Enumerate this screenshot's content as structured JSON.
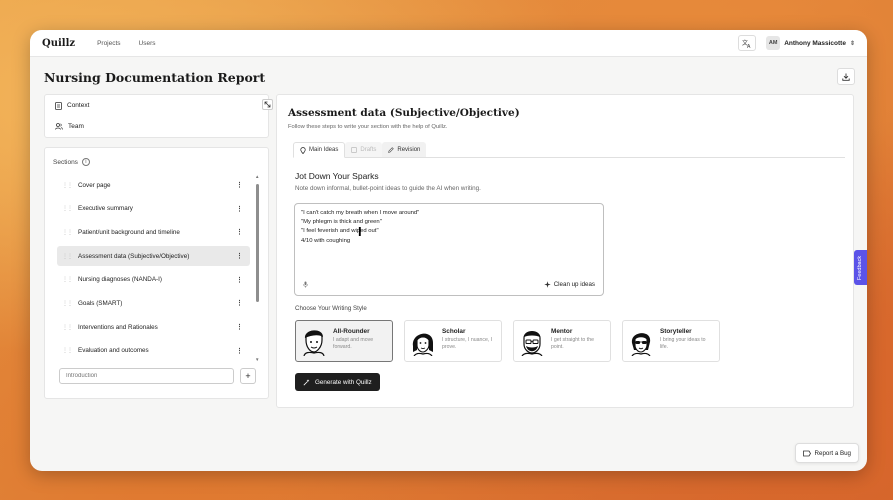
{
  "topbar": {
    "logo": "Quillz",
    "nav": [
      "Projects",
      "Users"
    ],
    "user_initials": "AM",
    "user_name": "Anthony Massicotte"
  },
  "page": {
    "title": "Nursing Documentation Report"
  },
  "context_panel": {
    "items": [
      "Context",
      "Team"
    ]
  },
  "sections": {
    "heading": "Sections",
    "items": [
      "Cover page",
      "Executive summary",
      "Patient/unit background and timeline",
      "Assessment data (Subjective/Objective)",
      "Nursing diagnoses (NANDA-I)",
      "Goals (SMART)",
      "Interventions and Rationales",
      "Evaluation and outcomes"
    ],
    "active_index": 3,
    "new_placeholder": "Introduction"
  },
  "main": {
    "title": "Assessment data (Subjective/Objective)",
    "subtitle": "Follow these steps to write your section with the help of Quillz.",
    "tabs": [
      "Main Ideas",
      "Drafts",
      "Revision"
    ],
    "step_title": "Jot Down Your Sparks",
    "step_desc": "Note down informal, bullet-point ideas to guide the AI when writing.",
    "ideas": [
      "\"I can't catch my breath when I move around\"",
      "\"My phlegm is thick and green\"",
      "\"I feel feverish and wiped out\"",
      "4/10 with coughing"
    ],
    "cleanup_label": "Clean up ideas",
    "style_label": "Choose Your Writing Style",
    "styles": [
      {
        "name": "All-Rounder",
        "desc": "I adapt and move forward."
      },
      {
        "name": "Scholar",
        "desc": "I structure, I nuance, I prove."
      },
      {
        "name": "Mentor",
        "desc": "I get straight to the point."
      },
      {
        "name": "Storyteller",
        "desc": "I bring your ideas to life."
      }
    ],
    "generate_label": "Generate with Quillz"
  },
  "feedback_label": "Feedback",
  "bug_label": "Report a Bug",
  "icons": [
    "translate-icon",
    "download-icon",
    "document-icon",
    "team-icon",
    "info-icon",
    "drag-handle-icon",
    "kebab-icon",
    "plus-icon",
    "bulb-icon",
    "drafts-icon",
    "pencil-icon",
    "mic-icon",
    "sparkle-icon",
    "wand-icon",
    "bug-icon"
  ]
}
